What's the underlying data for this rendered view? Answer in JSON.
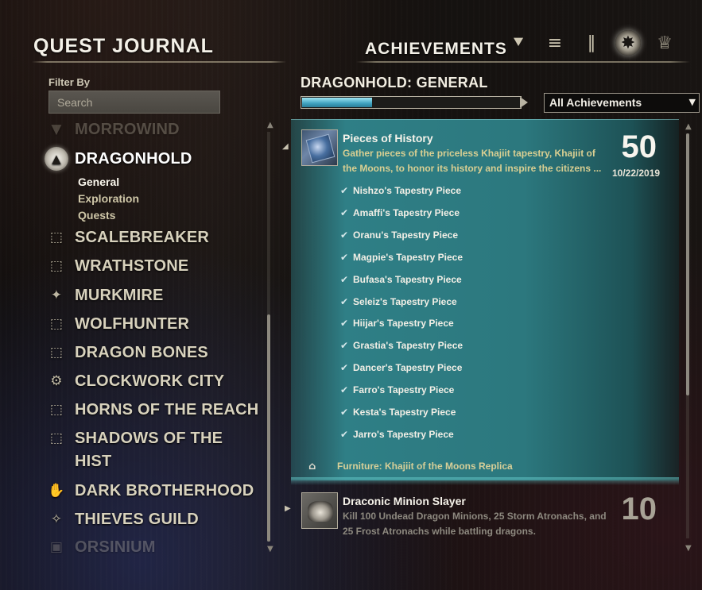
{
  "header": {
    "quest_title": "QUEST JOURNAL",
    "achievements_title": "ACHIEVEMENTS",
    "icons": [
      {
        "name": "quest-journal-icon",
        "glyph": "⯆"
      },
      {
        "name": "scroll-icon",
        "glyph": "📜"
      },
      {
        "name": "books-icon",
        "glyph": "📚"
      },
      {
        "name": "achievements-emblem-icon",
        "glyph": "✸"
      },
      {
        "name": "trophy-icon",
        "glyph": "🏆"
      }
    ]
  },
  "filter": {
    "label": "Filter By",
    "search_placeholder": "Search"
  },
  "categories": {
    "morrowind": {
      "label": "MORROWIND",
      "icon": "morrowind-icon"
    },
    "dragonhold": {
      "label": "DRAGONHOLD",
      "icon": "dragonhold-icon"
    },
    "subcats": [
      "General",
      "Exploration",
      "Quests"
    ],
    "scalebreaker": {
      "label": "SCALEBREAKER",
      "icon": "dlc-icon"
    },
    "wrathstone": {
      "label": "WRATHSTONE",
      "icon": "dlc-icon"
    },
    "murkmire": {
      "label": "MURKMIRE",
      "icon": "murkmire-icon"
    },
    "wolfhunter": {
      "label": "WOLFHUNTER",
      "icon": "dlc-icon"
    },
    "dragon_bones": {
      "label": "DRAGON BONES",
      "icon": "dlc-icon"
    },
    "clockwork_city": {
      "label": "CLOCKWORK CITY",
      "icon": "clockwork-icon"
    },
    "horns_of_the_reach": {
      "label": "HORNS OF THE REACH",
      "icon": "dlc-icon"
    },
    "shadows_line1": "SHADOWS OF THE",
    "shadows_line2": "HIST",
    "dark_brotherhood": {
      "label": "DARK BROTHERHOOD",
      "icon": "dark-brotherhood-icon"
    },
    "thieves_guild": {
      "label": "THIEVES GUILD",
      "icon": "thieves-guild-icon"
    },
    "orsinium": {
      "label": "ORSINIUM",
      "icon": "orsinium-icon"
    }
  },
  "main": {
    "heading": "DRAGONHOLD: GENERAL",
    "progress_fraction": 0.32,
    "filter_select": "All Achievements"
  },
  "achievements": [
    {
      "name": "Pieces of History",
      "description_line1": "Gather pieces of the priceless Khajiit tapestry, Khajiit of",
      "description_line2": "the Moons, to honor its history and inspire the citizens ...",
      "points": "50",
      "date": "10/22/2019",
      "criteria": [
        "Nishzo's Tapestry Piece",
        "Amaffi's Tapestry Piece",
        "Oranu's Tapestry Piece",
        "Magpie's Tapestry Piece",
        "Bufasa's Tapestry Piece",
        "Seleiz's Tapestry Piece",
        "Hiijar's Tapestry Piece",
        "Grastia's Tapestry Piece",
        "Dancer's Tapestry Piece",
        "Farro's Tapestry Piece",
        "Kesta's Tapestry Piece",
        "Jarro's Tapestry Piece"
      ],
      "reward": "Furniture: Khajiit of the Moons Replica"
    },
    {
      "name": "Draconic Minion Slayer",
      "description_line1": "Kill 100 Undead Dragon Minions, 25 Storm Atronachs, and",
      "description_line2": "25 Frost Atronachs while battling dragons.",
      "points": "10"
    }
  ]
}
